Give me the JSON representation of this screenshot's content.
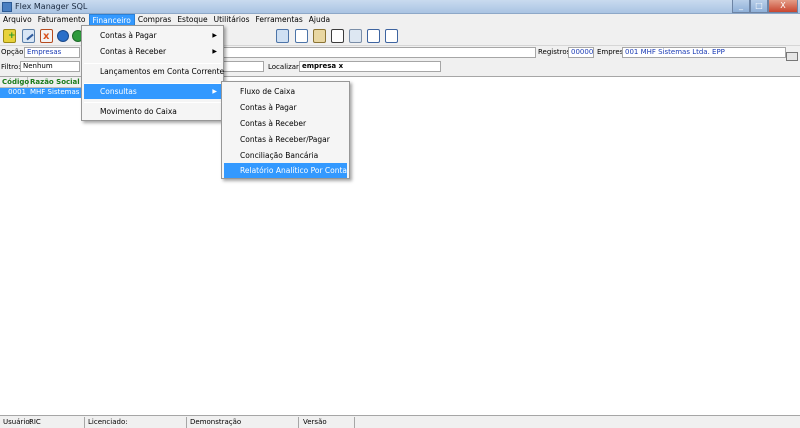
{
  "window": {
    "title": "Flex Manager SQL",
    "min": "_",
    "max": "□",
    "close": "X"
  },
  "menubar": [
    "Arquivo",
    "Faturamento",
    "Financeiro",
    "Compras",
    "Estoque",
    "Utilitários",
    "Ferramentas",
    "Ajuda"
  ],
  "toolbar_icons": [
    "new-icon",
    "edit-icon",
    "delete-icon",
    "back-icon",
    "forward-icon",
    "report-icon",
    "calculator-icon",
    "clipboard-icon",
    "table-icon",
    "tools-icon",
    "list-icon",
    "chart-window-icon"
  ],
  "option": {
    "label": "Opção:",
    "value": "Empresas"
  },
  "registros": {
    "label": "Registros:",
    "value": "000001"
  },
  "empresa": {
    "label": "Empresa",
    "value": "001 MHF Sistemas Ltda. EPP"
  },
  "filtro": {
    "label": "Filtro:",
    "value": "Nenhum"
  },
  "localizar": {
    "label": "Localizar:",
    "value": "empresa x"
  },
  "grid": {
    "headers": [
      "Código",
      "Razão Social"
    ],
    "rows": [
      {
        "codigo": "0001",
        "razao": "MHF Sistemas Ltda"
      }
    ]
  },
  "financeiro_menu": {
    "items": [
      "Contas à Pagar",
      "Contas à Receber",
      "Lançamentos em Conta Corrente",
      "Consultas",
      "Movimento do Caixa"
    ]
  },
  "consultas_menu": {
    "items": [
      "Fluxo de Caixa",
      "Contas à Pagar",
      "Contas à Receber",
      "Contas à Receber/Pagar",
      "Conciliação Bancária",
      "Relatório Analítico Por Conta"
    ]
  },
  "status": {
    "usuario_label": "Usuário:",
    "usuario_value": "RIC",
    "licenciado_label": "Licenciado:",
    "modo": "Demonstração",
    "versao_label": "Versão"
  },
  "colors": {
    "highlight": "#3399ff",
    "header_green": "#1a7a1a",
    "field_blue": "#1a3bb5"
  }
}
